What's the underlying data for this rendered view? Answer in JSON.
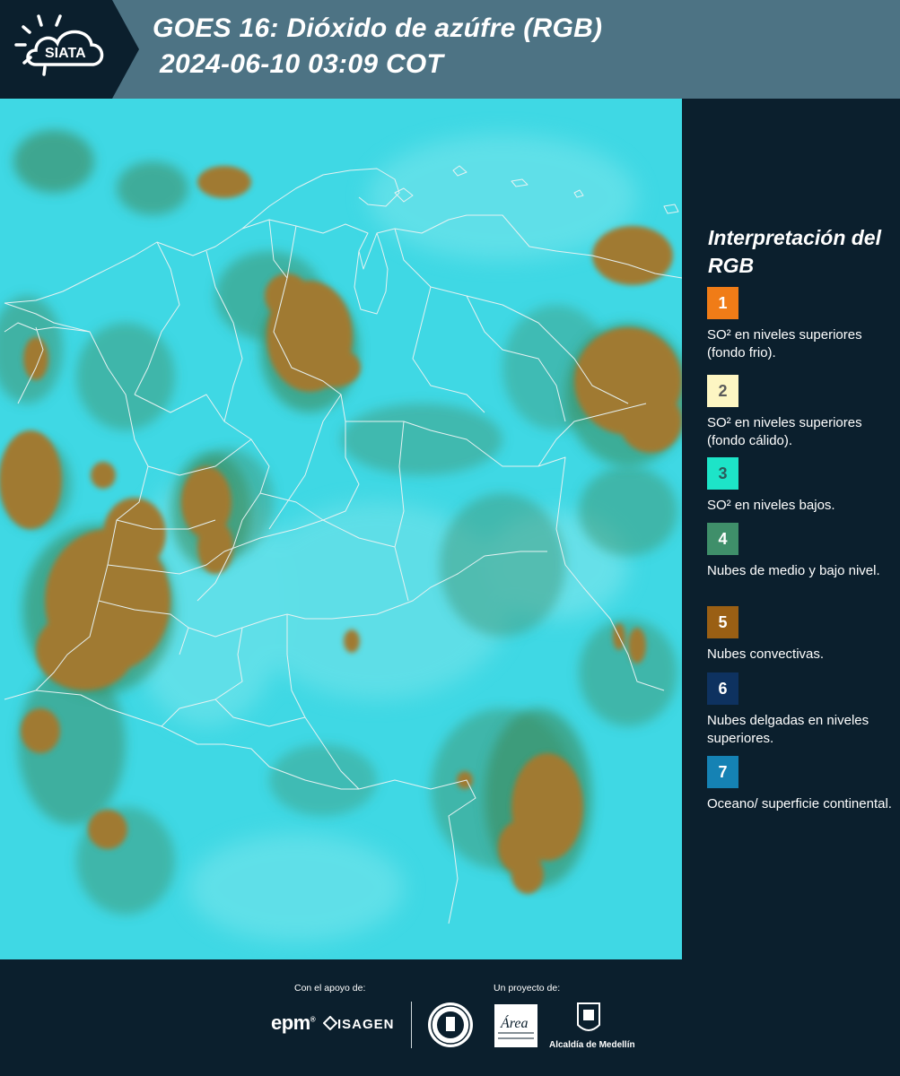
{
  "header": {
    "logo_text": "SIATA",
    "title_line1": "GOES 16: Dióxido de azúfre (RGB)",
    "title_line2": "2024-06-10 03:09 COT"
  },
  "legend": {
    "title": "Interpretación del RGB",
    "items": [
      {
        "number": "1",
        "color": "#f07c17",
        "number_color": "#ffffff",
        "description": "SO² en niveles superiores (fondo frio)."
      },
      {
        "number": "2",
        "color": "#fdf6c3",
        "number_color": "#5a5a5a",
        "description": "SO² en niveles superiores (fondo cálido)."
      },
      {
        "number": "3",
        "color": "#1de4c8",
        "number_color": "#2c5a5a",
        "description": "SO² en niveles bajos."
      },
      {
        "number": "4",
        "color": "#3f8f6a",
        "number_color": "#ffffff",
        "description": "Nubes de medio y bajo nivel."
      },
      {
        "number": "5",
        "color": "#9a5f14",
        "number_color": "#ffffff",
        "description": "Nubes convectivas."
      },
      {
        "number": "6",
        "color": "#0e3260",
        "number_color": "#ffffff",
        "description": "Nubes delgadas en niveles superiores."
      },
      {
        "number": "7",
        "color": "#1582b4",
        "number_color": "#ffffff",
        "description": "Oceano/ superficie continental."
      }
    ]
  },
  "footer": {
    "support_label": "Con el apoyo de:",
    "project_label": "Un proyecto de:",
    "epm_text": "epm",
    "isagen_text": "ISAGEN",
    "area_text": "Área",
    "alcaldia_text": "Alcaldía de Medellín"
  },
  "colors": {
    "header_bg": "#4d7384",
    "panel_bg": "#0b1f2d",
    "surface_cyan": "#40d9e6",
    "convective_brown": "#a07a32",
    "low_cloud_green": "#3f9a7a"
  }
}
